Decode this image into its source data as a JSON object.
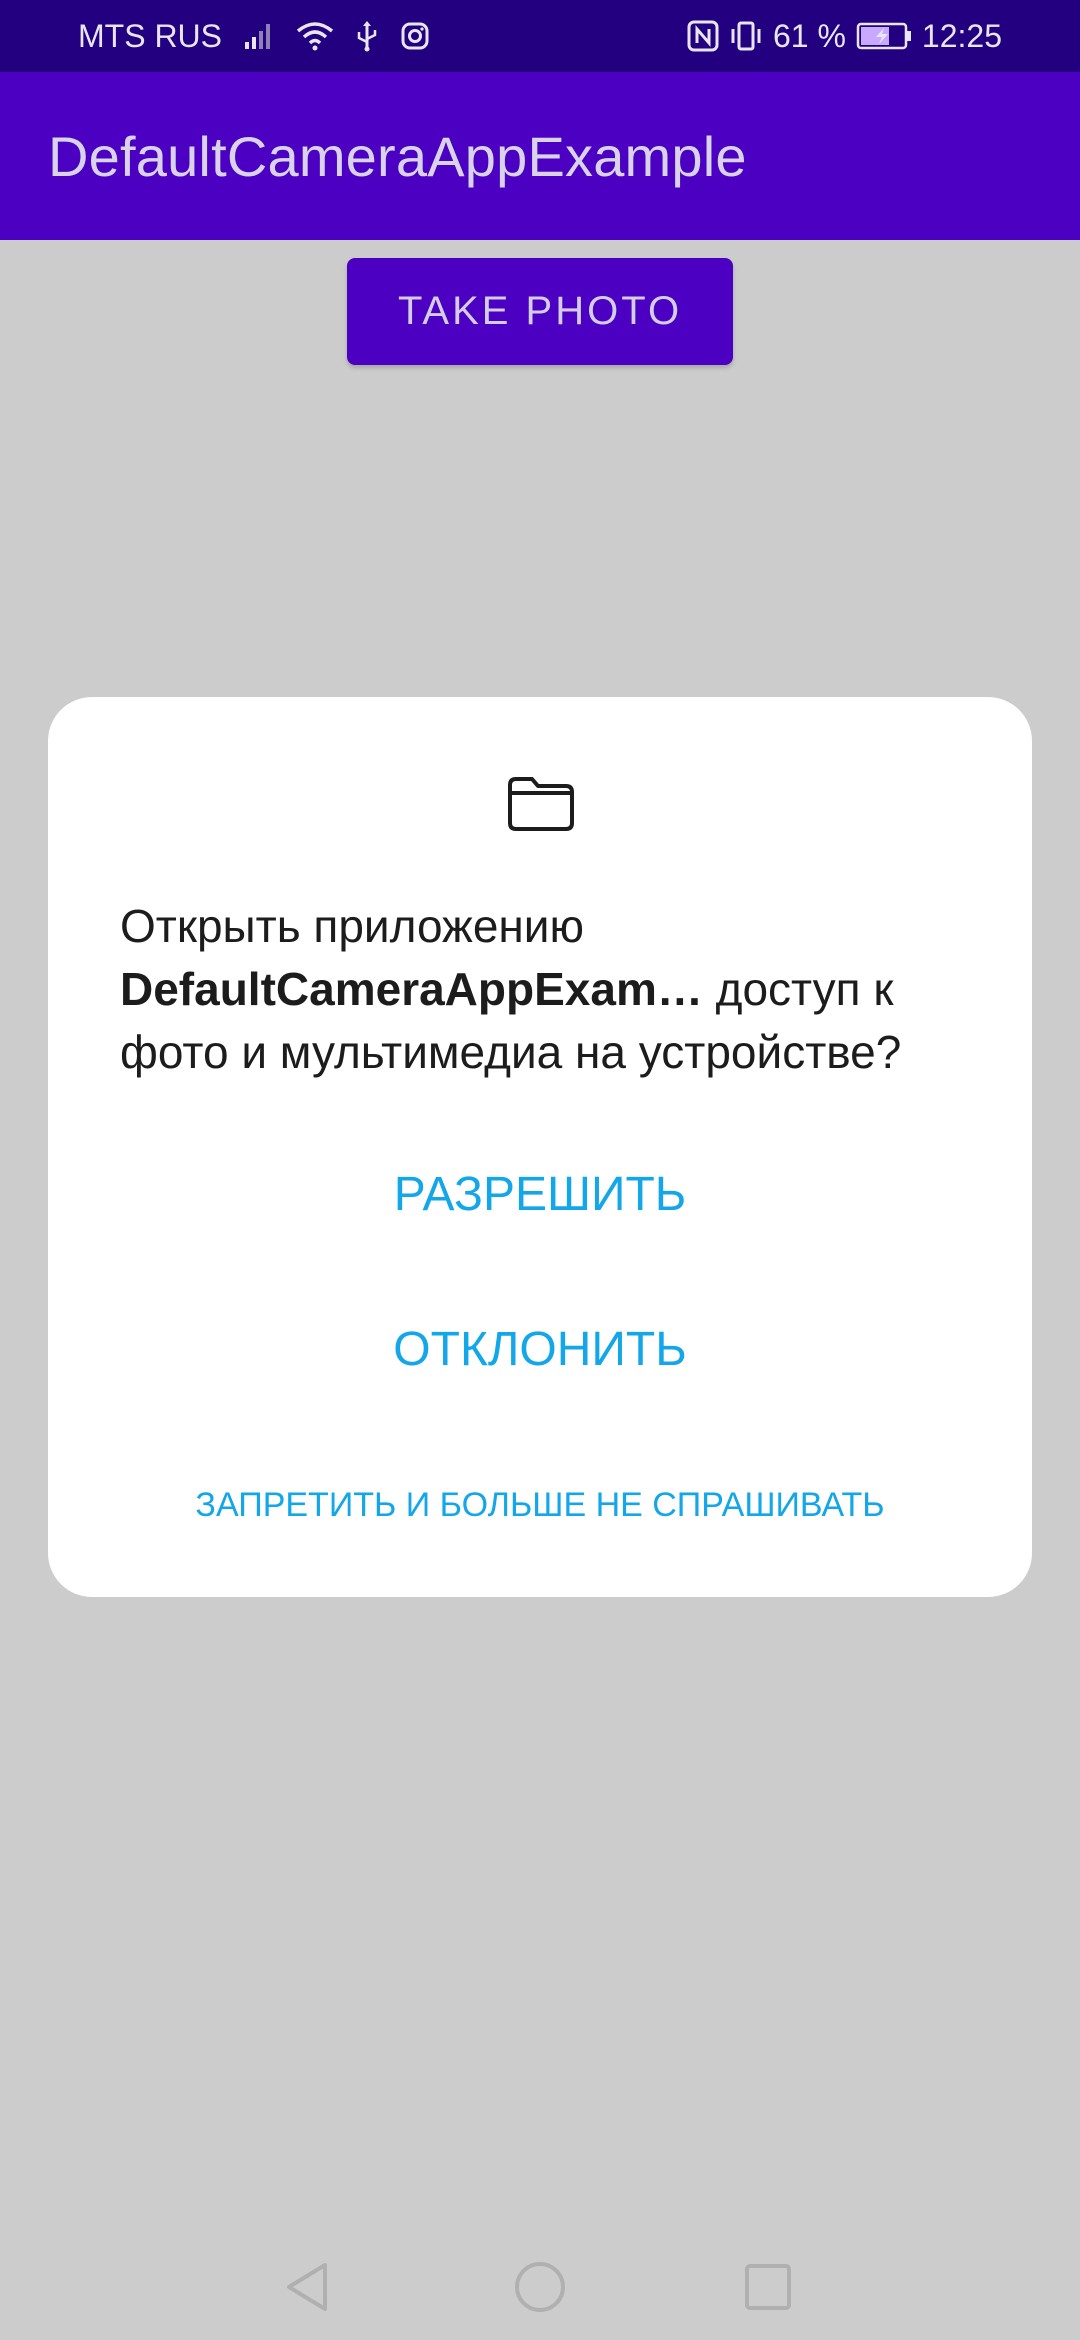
{
  "status_bar": {
    "carrier": "MTS RUS",
    "battery_percent": "61 %",
    "time": "12:25",
    "icons": [
      "signal-icon",
      "wifi-icon",
      "usb-icon",
      "instagram-icon",
      "nfc-icon",
      "vibrate-icon",
      "battery-charging-icon"
    ]
  },
  "app_bar": {
    "title": "DefaultCameraAppExample"
  },
  "main": {
    "take_photo_label": "TAKE PHOTO"
  },
  "dialog": {
    "icon": "folder-icon",
    "message_prefix": "Открыть приложению ",
    "app_name": "DefaultCameraAppExam…",
    "message_suffix": " доступ к фото и мультимедиа на устройстве?",
    "allow_label": "РАЗРЕШИТЬ",
    "deny_label": "ОТКЛОНИТЬ",
    "deny_forever_label": "ЗАПРЕТИТЬ И БОЛЬШЕ НЕ СПРАШИВАТЬ"
  },
  "nav_bar": {
    "icons": [
      "back-icon",
      "home-icon",
      "recents-icon"
    ]
  },
  "colors": {
    "status_bar": "#22007f",
    "app_bar": "#4b00c2",
    "scrim_background": "#cccccc",
    "dialog_accent": "#13a6e8"
  }
}
